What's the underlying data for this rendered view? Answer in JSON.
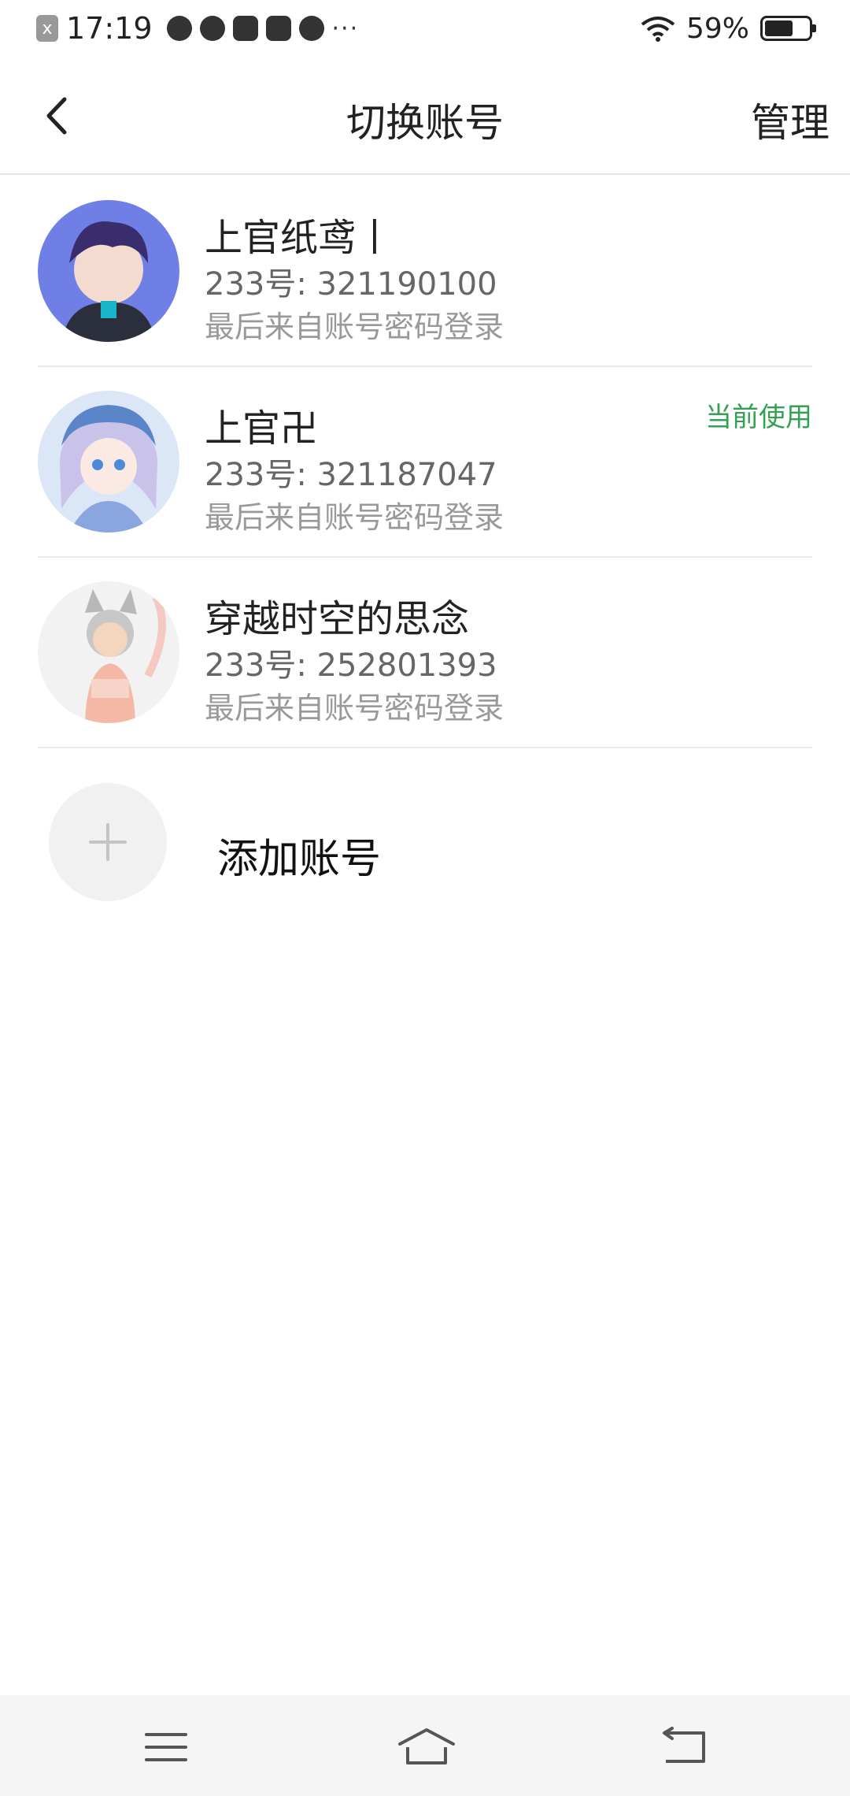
{
  "status_bar": {
    "time": "17:19",
    "notification_icon": "x",
    "app_icons": [
      "cloud-icon",
      "fan-icon",
      "music-icon",
      "app-icon",
      "play-icon"
    ],
    "more": "···",
    "battery_text": "59%",
    "battery_level": 0.59
  },
  "header": {
    "title": "切换账号",
    "manage_label": "管理"
  },
  "accounts": [
    {
      "name": "上官纸鸢丨",
      "id": "233号: 321190100",
      "login": "最后来自账号密码登录",
      "current": ""
    },
    {
      "name": "上官卍",
      "id": "233号: 321187047",
      "login": "最后来自账号密码登录",
      "current": "当前使用"
    },
    {
      "name": "穿越时空的思念",
      "id": "233号: 252801393",
      "login": "最后来自账号密码登录",
      "current": ""
    }
  ],
  "add_account": {
    "label": "添加账号"
  },
  "colors": {
    "accent_green": "#33a153"
  }
}
